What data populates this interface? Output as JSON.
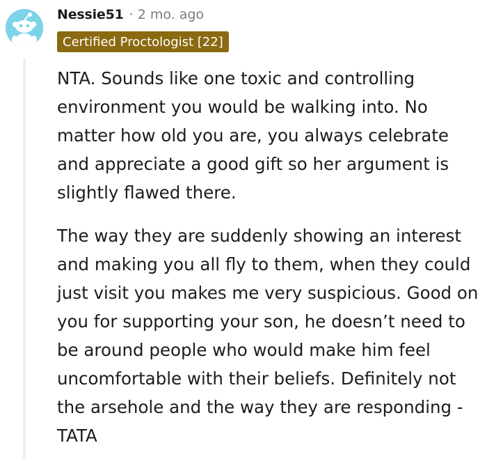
{
  "comment": {
    "username": "Nessie51",
    "separator": "·",
    "time": "2 mo. ago",
    "flair": "Certified Proctologist [22]",
    "paragraphs": [
      "NTA. Sounds like one toxic and controlling environment you would be walking into. No matter how old you are, you always celebrate and appreciate a good gift so her argument is slightly flawed there.",
      "The way they are suddenly showing an interest and making you all fly to them, when they could just visit you makes me very suspicious. Good on you for supporting your son, he doesn’t need to be around people who would make him feel uncomfortable with their beliefs. Definitely not the arsehole and the way they are responding - TATA"
    ]
  },
  "colors": {
    "avatar_bg": "#7dd3e8",
    "flair_bg": "#8b6910",
    "flair_text": "#ffffff",
    "meta_text": "#7c7c7c",
    "thread_line": "#edeff1"
  },
  "icons": {
    "avatar": "reddit-snoo-avatar-icon"
  }
}
